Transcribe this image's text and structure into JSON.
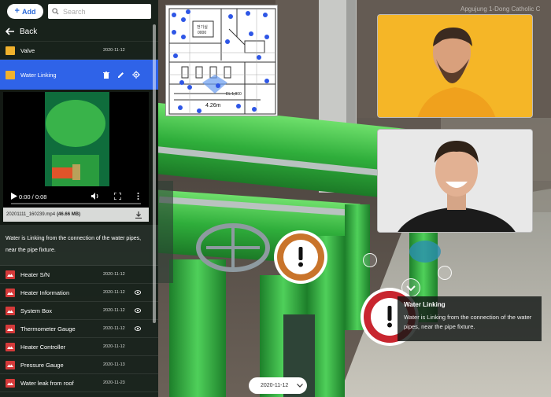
{
  "header": {
    "add_label": "Add",
    "search_placeholder": "Search"
  },
  "sidebar": {
    "back_label": "Back",
    "top_items": [
      {
        "label": "Valve",
        "date": "2020-11-12",
        "icon": "folder-icon"
      },
      {
        "label": "Water Linking",
        "icon": "folder-icon",
        "selected": true
      }
    ],
    "media": {
      "time": "0:00 / 0:08",
      "filename": "20201111_160239.mp4",
      "filesize": "(46.66 MB)"
    },
    "description": "Water is Linking from the connection of the water pipes, near the pipe fixture.",
    "items": [
      {
        "label": "Heater S/N",
        "date": "2020-11-12",
        "icon": "image-icon",
        "visible_eye": false
      },
      {
        "label": "Heater Information",
        "date": "2020-11-12",
        "icon": "image-icon",
        "visible_eye": true
      },
      {
        "label": "System Box",
        "date": "2020-11-12",
        "icon": "image-icon",
        "visible_eye": true
      },
      {
        "label": "Thermometer Gauge",
        "date": "2020-11-12",
        "icon": "image-icon",
        "visible_eye": true
      },
      {
        "label": "Heater Controller",
        "date": "2020-11-12",
        "icon": "image-icon",
        "visible_eye": false
      },
      {
        "label": "Pressure Gauge",
        "date": "2020-11-13",
        "icon": "image-icon",
        "visible_eye": false
      },
      {
        "label": "Water leak from roof",
        "date": "2020-11-23",
        "icon": "image-icon",
        "visible_eye": false
      },
      {
        "label": "Status on electrical",
        "date": "2020-11-23",
        "icon": "image-icon",
        "visible_eye": true
      }
    ]
  },
  "minimap": {
    "scale_label": "4.26m",
    "room_labels": [
      "전기실",
      "0000",
      "EL 1,000"
    ]
  },
  "scene": {
    "watermark": "Apgujung 1-Dong Catholic C",
    "tooltip_title": "Water Linking",
    "tooltip_body": "Water is Linking from the connection of the water pipes, near the pipe fixture.",
    "date_selector": "2020-11-12"
  },
  "colors": {
    "accent": "#2f63e8",
    "pipe_green": "#3fb84a",
    "hotspot_orange": "#c9742b",
    "hotspot_red": "#c8262f",
    "folder": "#f1b22d",
    "image_item": "#d53a3a"
  }
}
